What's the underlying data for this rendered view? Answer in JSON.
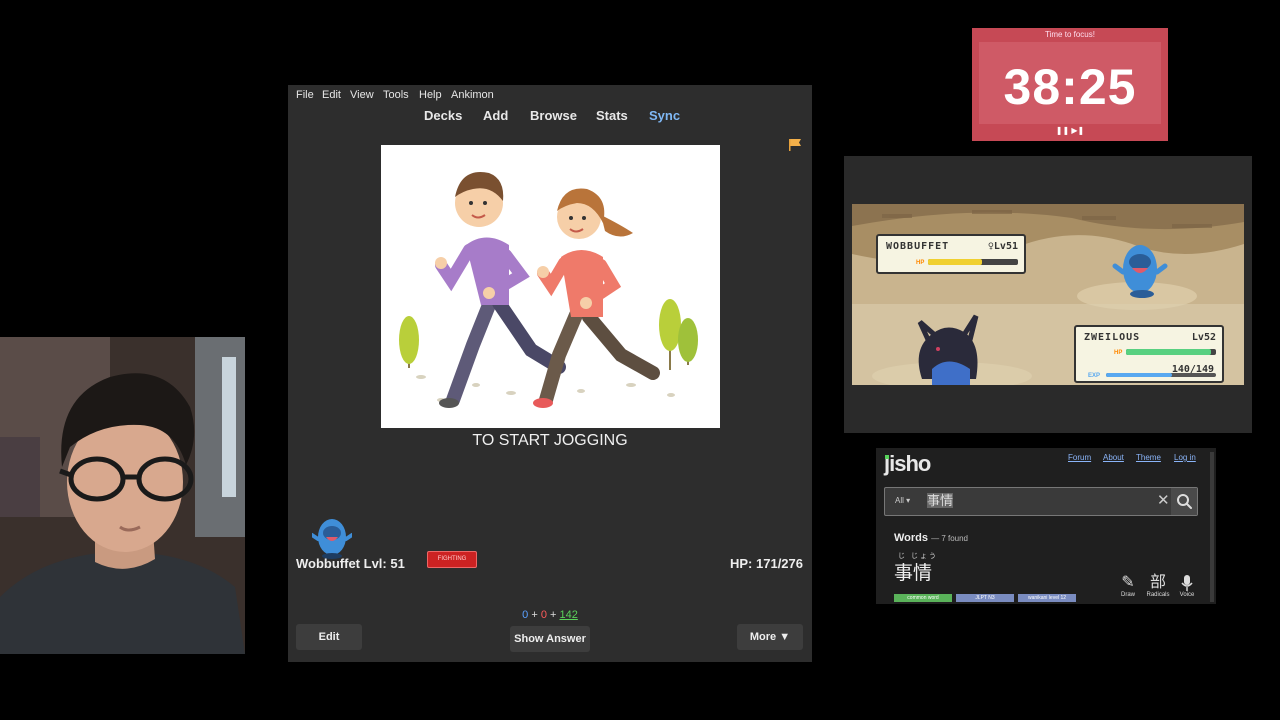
{
  "anki": {
    "menu": [
      "File",
      "Edit",
      "View",
      "Tools",
      "Help",
      "Ankimon"
    ],
    "toolbar": [
      "Decks",
      "Add",
      "Browse",
      "Stats",
      "Sync"
    ],
    "card_text": "TO START JOGGING",
    "pet_name": "Wobbuffet Lvl: 51",
    "pet_type": "FIGHTING",
    "hp": "HP: 171/276",
    "counts": {
      "new": "0",
      "learning": "0",
      "review": "142",
      "plus": "+"
    },
    "buttons": {
      "edit": "Edit",
      "show_answer": "Show Answer",
      "more": "More ▼"
    }
  },
  "timer": {
    "title": "Time to focus!",
    "time": "38:25",
    "controls": "❚❚ ▶❚"
  },
  "battle": {
    "enemy": {
      "name": "WOBBUFFET",
      "gender": "♀",
      "level": "Lv51",
      "hp_fraction": 0.6
    },
    "player": {
      "name": "ZWEILOUS",
      "level": "Lv52",
      "hp_text": "140/149",
      "hp_fraction": 0.94
    },
    "hp_label": "HP",
    "exp_label": "EXP"
  },
  "jisho": {
    "logo": "jisho",
    "nav": [
      "Forum",
      "About",
      "Theme",
      "Log in"
    ],
    "filter": "All ▾",
    "query": "事情",
    "words_label": "Words",
    "words_count": "— 7 found",
    "furigana": "じ じょう",
    "word": "事情",
    "tags": [
      "common word",
      "JLPT N3",
      "wanikani level 12"
    ],
    "tools": [
      {
        "glyph": "✎",
        "label": "Draw"
      },
      {
        "glyph": "部",
        "label": "Radicals"
      },
      {
        "glyph": "🎙",
        "label": "Voice"
      }
    ]
  },
  "colors": {
    "anki_bg": "#2d2d2d",
    "sync": "#7fb8f5",
    "timer_bg": "#c64955",
    "jisho_bg": "#1f1f1f",
    "jisho_green": "#56d35a"
  }
}
